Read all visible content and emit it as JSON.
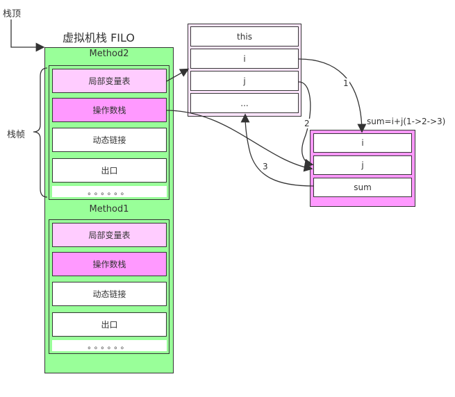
{
  "labels": {
    "stack_top": "栈顶",
    "vm_stack_title": "虚拟机栈 FILO",
    "stack_frame": "栈帧",
    "sum_formula": "sum=i+j(1->2->3)"
  },
  "method2": {
    "title": "Method2",
    "rows": [
      "局部变量表",
      "操作数栈",
      "动态链接",
      "出口"
    ],
    "dots": "。。。。。。"
  },
  "method1": {
    "title": "Method1",
    "rows": [
      "局部变量表",
      "操作数栈",
      "动态链接",
      "出口"
    ],
    "dots": "。。。。。。"
  },
  "local_vars": {
    "rows": [
      "this",
      "i",
      "j",
      "..."
    ]
  },
  "operand_stack": {
    "rows": [
      "i",
      "j",
      "sum"
    ]
  },
  "arrow_labels": [
    "1",
    "2",
    "3"
  ],
  "colors": {
    "green": "#99ff99",
    "light_pink": "#ffccff",
    "pink": "#ff99ff",
    "light_purple": "#ffe6ff"
  }
}
